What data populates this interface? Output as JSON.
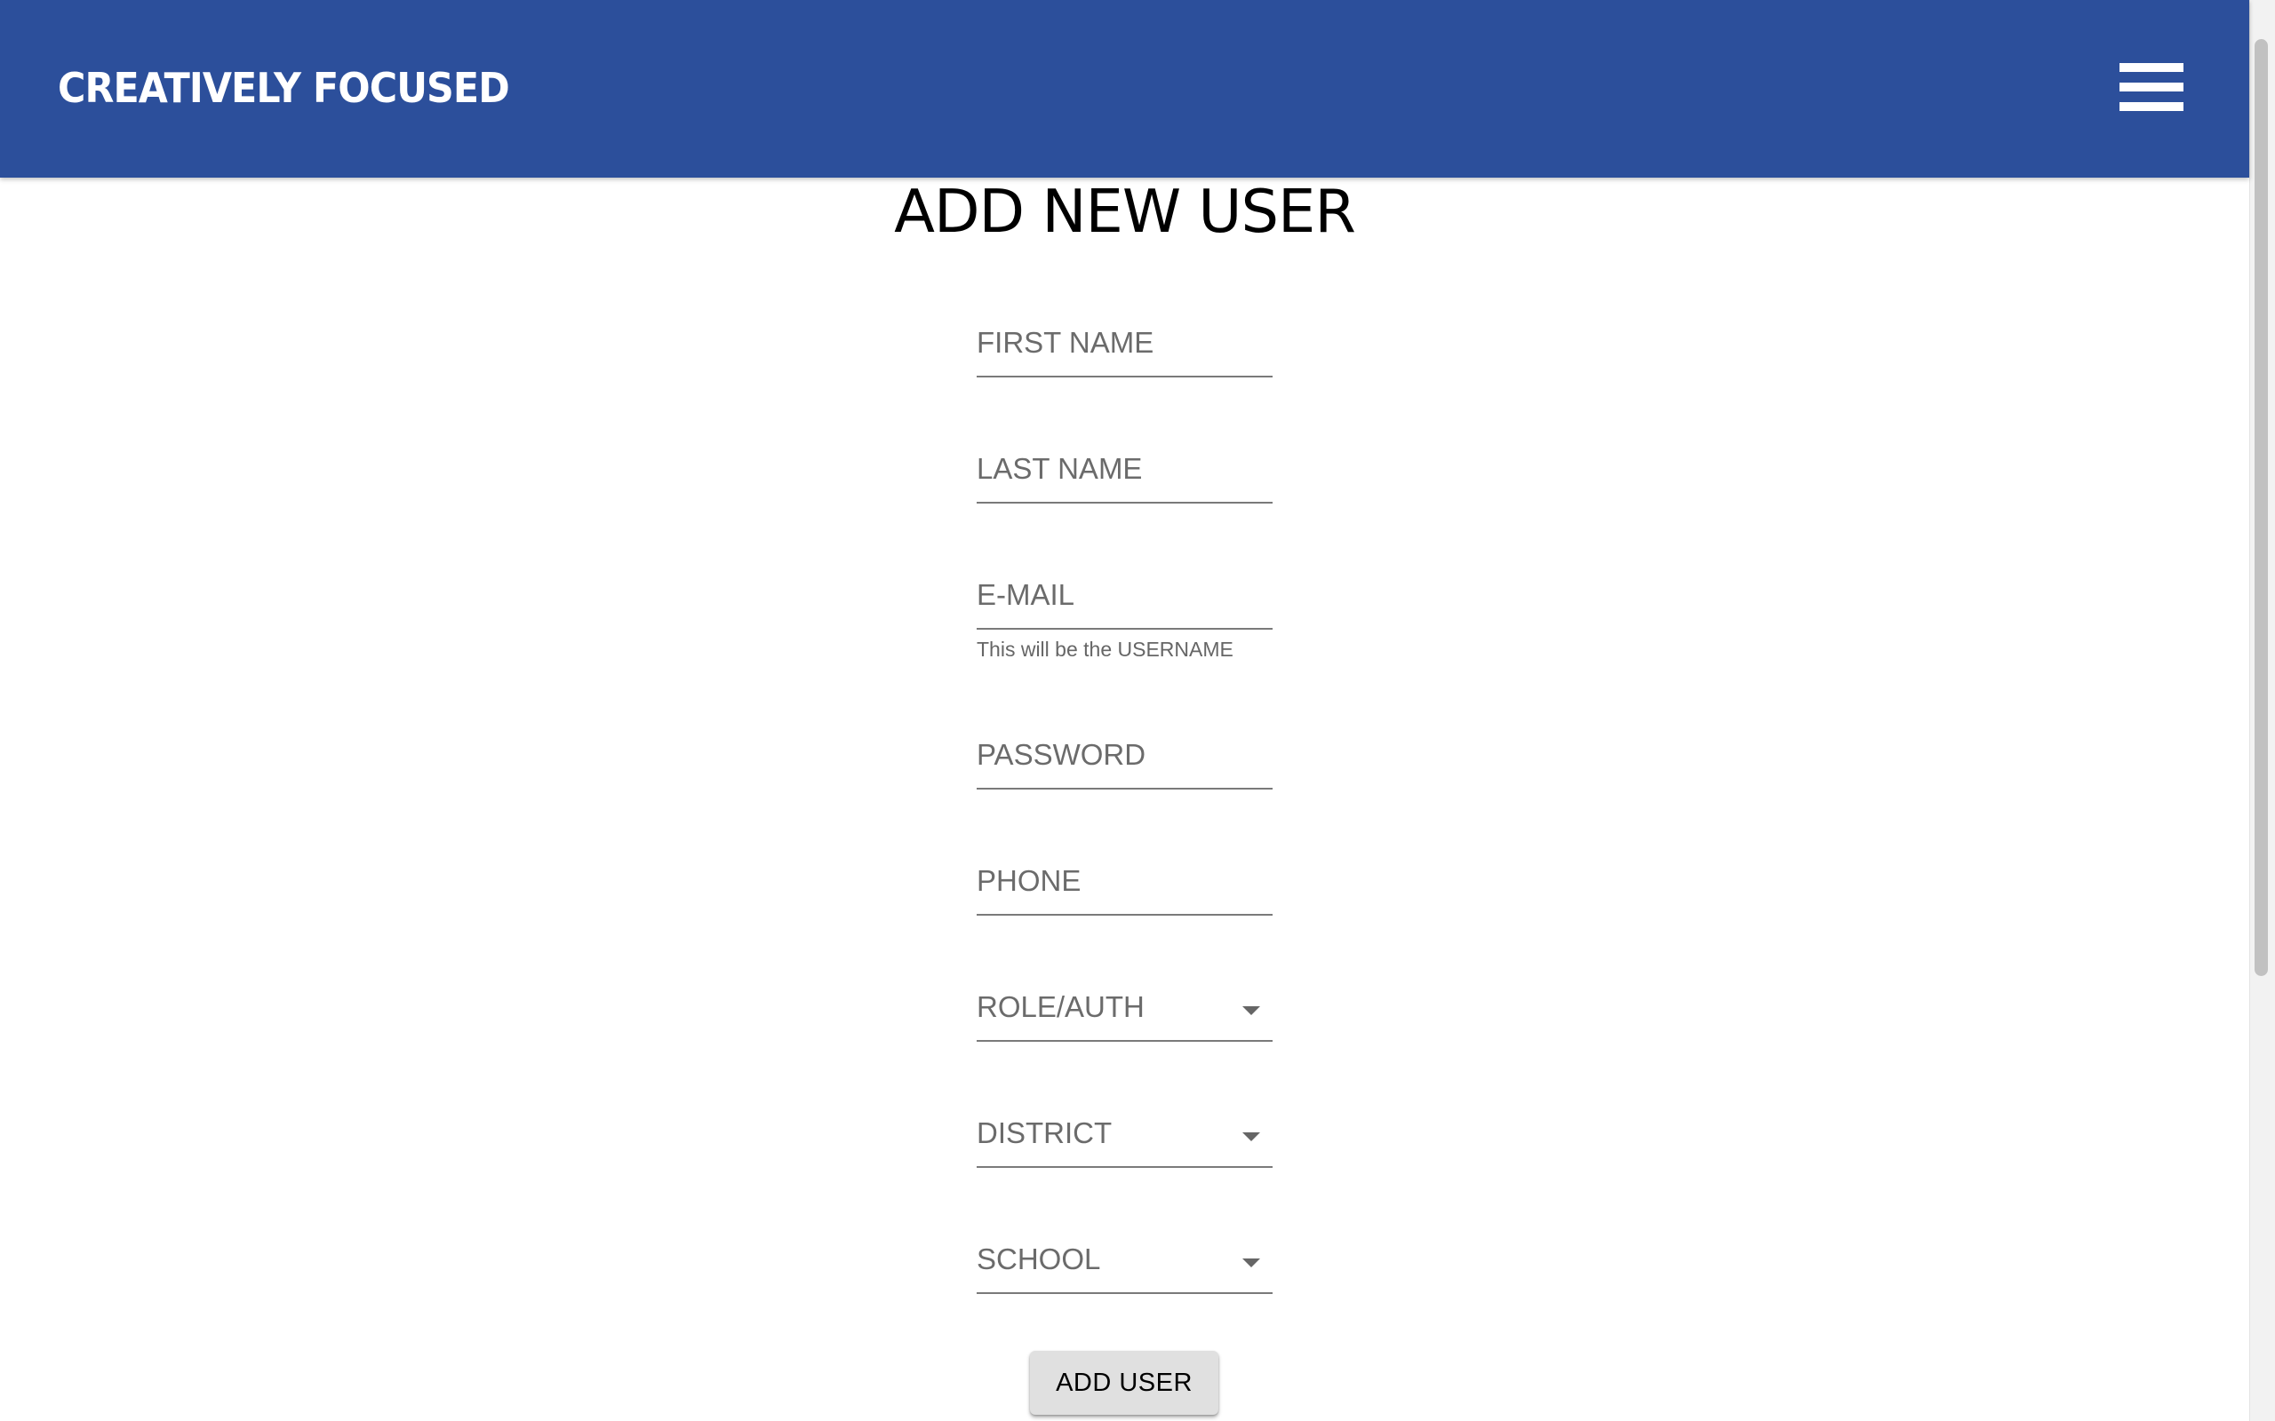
{
  "header": {
    "brand": "CREATIVELY FOCUSED",
    "color": "#2c4f9b",
    "menu_icon": "hamburger-menu-icon"
  },
  "page": {
    "title": "ADD NEW USER"
  },
  "form": {
    "first_name": {
      "placeholder": "FIRST NAME",
      "value": ""
    },
    "last_name": {
      "placeholder": "LAST NAME",
      "value": ""
    },
    "email": {
      "placeholder": "E-MAIL",
      "value": "",
      "helper": "This will be the USERNAME"
    },
    "password": {
      "placeholder": "PASSWORD",
      "value": ""
    },
    "phone": {
      "placeholder": "PHONE",
      "value": ""
    },
    "role": {
      "label": "ROLE/AUTH"
    },
    "district": {
      "label": "DISTRICT"
    },
    "school": {
      "label": "SCHOOL"
    },
    "submit_label": "ADD USER"
  }
}
